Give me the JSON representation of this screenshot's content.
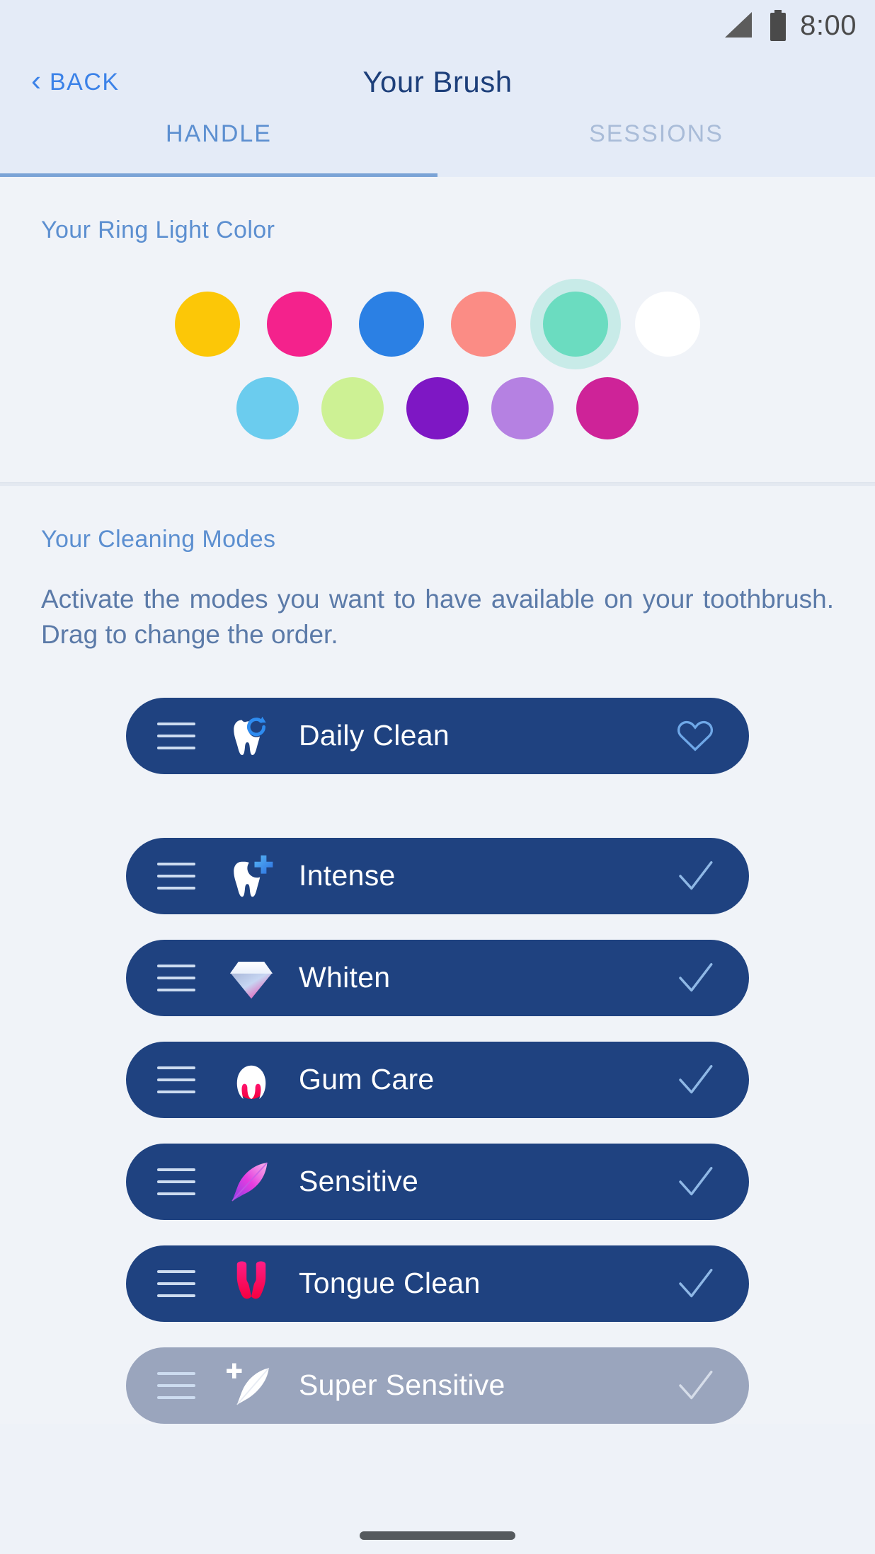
{
  "status_bar": {
    "time": "8:00",
    "signal_icon": "signal-bars-icon",
    "battery_icon": "battery-full-icon"
  },
  "nav": {
    "back_label": "BACK",
    "back_icon": "chevron-left-icon",
    "title": "Your Brush"
  },
  "tabs": [
    {
      "label": "HANDLE",
      "active": true
    },
    {
      "label": "SESSIONS",
      "active": false
    }
  ],
  "ring_light": {
    "section_label": "Your Ring Light Color",
    "selected_index": 4,
    "row1": [
      {
        "name": "yellow",
        "hex": "#FCC707"
      },
      {
        "name": "magenta",
        "hex": "#F4228C"
      },
      {
        "name": "blue",
        "hex": "#2B80E4"
      },
      {
        "name": "salmon",
        "hex": "#FB8C85"
      },
      {
        "name": "teal",
        "hex": "#6BDCC0"
      },
      {
        "name": "white",
        "hex": "#FFFFFF"
      }
    ],
    "row2": [
      {
        "name": "sky-blue",
        "hex": "#6BCCEE"
      },
      {
        "name": "lime",
        "hex": "#CDF194"
      },
      {
        "name": "violet",
        "hex": "#7E17C4"
      },
      {
        "name": "light-purple",
        "hex": "#B581E2"
      },
      {
        "name": "pink-purple",
        "hex": "#CE2398"
      }
    ]
  },
  "cleaning_modes": {
    "section_label": "Your Cleaning Modes",
    "description": "Activate the modes you want to have available on your toothbrush. Drag to change the order.",
    "items": [
      {
        "label": "Daily Clean",
        "icon": "tooth-refresh-icon",
        "action_icon": "heart-icon",
        "state": "favorite",
        "enabled": true
      },
      {
        "label": "Intense",
        "icon": "tooth-plus-icon",
        "action_icon": "check-icon",
        "state": "selected",
        "enabled": true
      },
      {
        "label": "Whiten",
        "icon": "diamond-icon",
        "action_icon": "check-icon",
        "state": "selected",
        "enabled": true
      },
      {
        "label": "Gum Care",
        "icon": "tooth-gum-icon",
        "action_icon": "check-icon",
        "state": "selected",
        "enabled": true
      },
      {
        "label": "Sensitive",
        "icon": "feather-icon",
        "action_icon": "check-icon",
        "state": "selected",
        "enabled": true
      },
      {
        "label": "Tongue Clean",
        "icon": "tongue-icon",
        "action_icon": "check-icon",
        "state": "selected",
        "enabled": true
      },
      {
        "label": "Super Sensitive",
        "icon": "feather-plus-icon",
        "action_icon": "check-icon",
        "state": "disabled",
        "enabled": false
      }
    ]
  },
  "colors": {
    "background": "#eef2f8",
    "header_background": "#e4ebf7",
    "accent_blue": "#3b82e8",
    "title_navy": "#1d3f7a",
    "tab_active": "#5c8fd0",
    "tab_inactive": "#a9bcd8",
    "pill_active": "#1f4280",
    "pill_disabled": "#9aa5bd"
  }
}
